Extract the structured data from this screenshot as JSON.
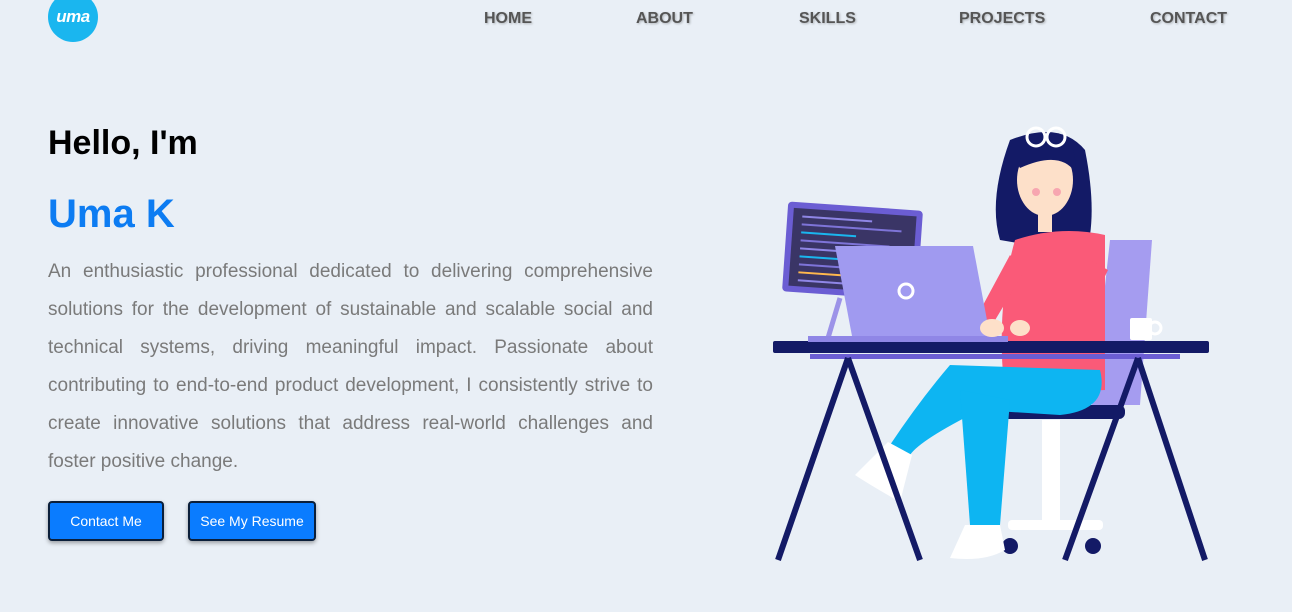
{
  "header": {
    "logo_text": "uma",
    "nav": [
      "HOME",
      "ABOUT",
      "SKILLS",
      "PROJECTS",
      "CONTACT"
    ]
  },
  "hero": {
    "greeting": "Hello, I'm",
    "name": "Uma K",
    "bio": "An enthusiastic professional dedicated to delivering comprehensive solutions for the development of sustainable and scalable social and technical systems, driving meaningful impact. Passionate about contributing to end-to-end product development, I consistently strive to create innovative solutions that address real-world challenges and foster positive change.",
    "buttons": {
      "contact": "Contact Me",
      "resume": "See My Resume"
    }
  },
  "colors": {
    "background": "#e9eff6",
    "accent": "#0d7cf2",
    "button": "#0a7cff",
    "logo": "#1ab6ef"
  },
  "illustration": {
    "description_icon": "woman-working-at-laptop-illustration"
  }
}
